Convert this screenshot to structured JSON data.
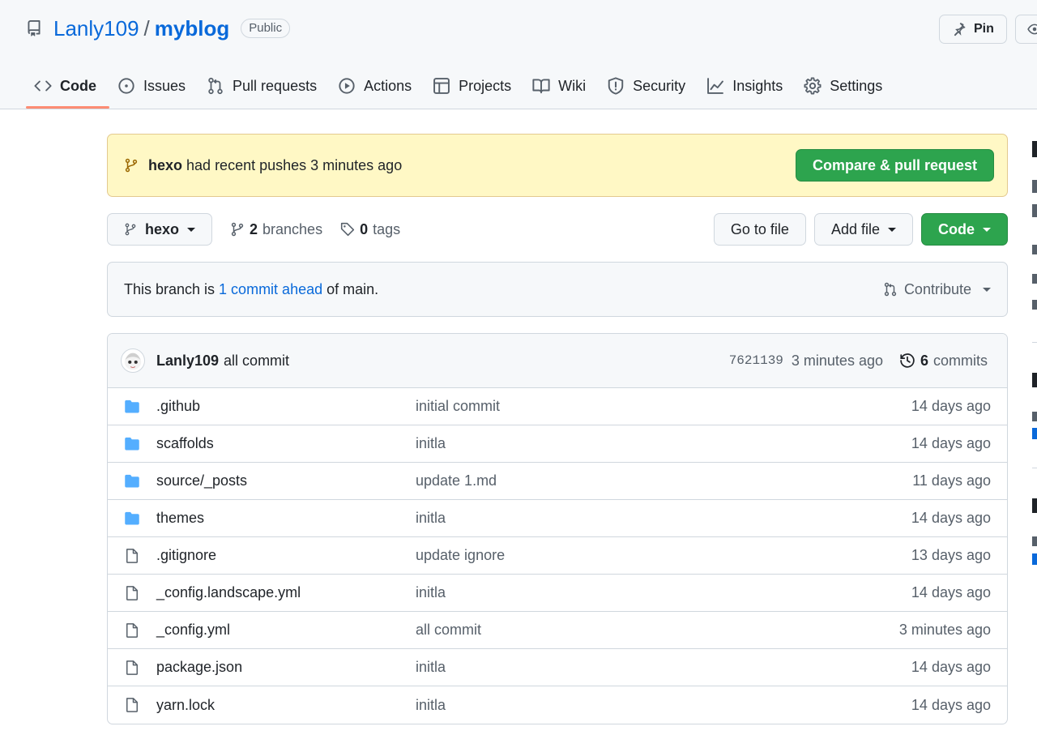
{
  "repo": {
    "owner": "Lanly109",
    "separator": "/",
    "name": "myblog",
    "visibility": "Public"
  },
  "header_buttons": {
    "pin": "Pin"
  },
  "tabs": [
    {
      "label": "Code",
      "icon": "code-icon",
      "selected": true
    },
    {
      "label": "Issues",
      "icon": "issue-icon"
    },
    {
      "label": "Pull requests",
      "icon": "pull-request-icon"
    },
    {
      "label": "Actions",
      "icon": "play-icon"
    },
    {
      "label": "Projects",
      "icon": "table-icon"
    },
    {
      "label": "Wiki",
      "icon": "book-icon"
    },
    {
      "label": "Security",
      "icon": "shield-icon"
    },
    {
      "label": "Insights",
      "icon": "graph-icon"
    },
    {
      "label": "Settings",
      "icon": "gear-icon"
    }
  ],
  "banner": {
    "branch": "hexo",
    "text": "had recent pushes 3 minutes ago",
    "button": "Compare & pull request"
  },
  "toolbar": {
    "branch": "hexo",
    "branches_count": "2",
    "branches_label": "branches",
    "tags_count": "0",
    "tags_label": "tags",
    "go_to_file": "Go to file",
    "add_file": "Add file",
    "code": "Code"
  },
  "branch_status": {
    "prefix": "This branch is",
    "link": "1 commit ahead",
    "suffix": "of main.",
    "contribute": "Contribute"
  },
  "latest_commit": {
    "author": "Lanly109",
    "message": "all commit",
    "sha": "7621139",
    "time": "3 minutes ago",
    "commits_count": "6",
    "commits_label": "commits"
  },
  "files": [
    {
      "name": ".github",
      "type": "folder",
      "message": "initial commit",
      "date": "14 days ago"
    },
    {
      "name": "scaffolds",
      "type": "folder",
      "message": "initla",
      "date": "14 days ago"
    },
    {
      "name": "source/_posts",
      "type": "folder",
      "message": "update 1.md",
      "date": "11 days ago"
    },
    {
      "name": "themes",
      "type": "folder",
      "message": "initla",
      "date": "14 days ago"
    },
    {
      "name": ".gitignore",
      "type": "file",
      "message": "update ignore",
      "date": "13 days ago"
    },
    {
      "name": "_config.landscape.yml",
      "type": "file",
      "message": "initla",
      "date": "14 days ago"
    },
    {
      "name": "_config.yml",
      "type": "file",
      "message": "all commit",
      "date": "3 minutes ago"
    },
    {
      "name": "package.json",
      "type": "file",
      "message": "initla",
      "date": "14 days ago"
    },
    {
      "name": "yarn.lock",
      "type": "file",
      "message": "initla",
      "date": "14 days ago"
    }
  ],
  "colors": {
    "link": "#0969da",
    "primary_button": "#2da44e",
    "banner_bg": "#fff8c5",
    "tab_underline": "#fd8c73",
    "folder_icon": "#54aeff"
  }
}
